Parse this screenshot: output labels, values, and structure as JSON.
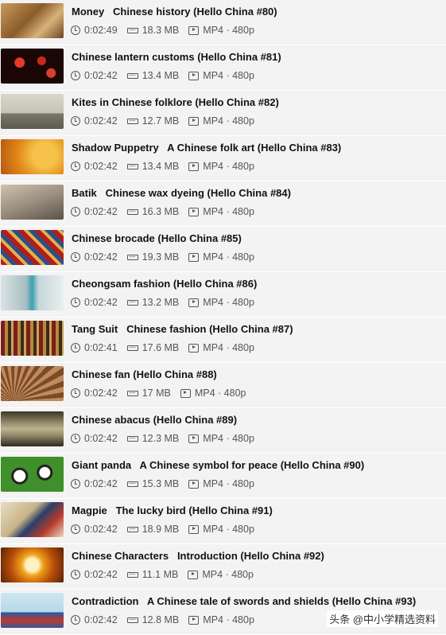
{
  "items": [
    {
      "title": "Money   Chinese history (Hello China #80)",
      "duration": "0:02:49",
      "size": "18.3 MB",
      "format": "MP4 · 480p",
      "thumb": "t-money"
    },
    {
      "title": "Chinese lantern customs (Hello China #81)",
      "duration": "0:02:42",
      "size": "13.4 MB",
      "format": "MP4 · 480p",
      "thumb": "t-lantern"
    },
    {
      "title": "Kites in Chinese folklore (Hello China #82)",
      "duration": "0:02:42",
      "size": "12.7 MB",
      "format": "MP4 · 480p",
      "thumb": "t-kites"
    },
    {
      "title": "Shadow Puppetry   A Chinese folk art (Hello China #83)",
      "duration": "0:02:42",
      "size": "13.4 MB",
      "format": "MP4 · 480p",
      "thumb": "t-shadow"
    },
    {
      "title": "Batik   Chinese wax dyeing (Hello China #84)",
      "duration": "0:02:42",
      "size": "16.3 MB",
      "format": "MP4 · 480p",
      "thumb": "t-batik"
    },
    {
      "title": "Chinese brocade (Hello China #85)",
      "duration": "0:02:42",
      "size": "19.3 MB",
      "format": "MP4 · 480p",
      "thumb": "t-brocade"
    },
    {
      "title": "Cheongsam fashion (Hello China #86)",
      "duration": "0:02:42",
      "size": "13.2 MB",
      "format": "MP4 · 480p",
      "thumb": "t-cheong"
    },
    {
      "title": "Tang Suit   Chinese fashion (Hello China #87)",
      "duration": "0:02:41",
      "size": "17.6 MB",
      "format": "MP4 · 480p",
      "thumb": "t-tang"
    },
    {
      "title": "Chinese fan (Hello China #88)",
      "duration": "0:02:42",
      "size": "17 MB",
      "format": "MP4 · 480p",
      "thumb": "t-fan"
    },
    {
      "title": "Chinese abacus (Hello China #89)",
      "duration": "0:02:42",
      "size": "12.3 MB",
      "format": "MP4 · 480p",
      "thumb": "t-abacus"
    },
    {
      "title": "Giant panda   A Chinese symbol for peace (Hello China #90)",
      "duration": "0:02:42",
      "size": "15.3 MB",
      "format": "MP4 · 480p",
      "thumb": "t-panda"
    },
    {
      "title": "Magpie   The lucky bird (Hello China #91)",
      "duration": "0:02:42",
      "size": "18.9 MB",
      "format": "MP4 · 480p",
      "thumb": "t-magpie"
    },
    {
      "title": "Chinese Characters   Introduction (Hello China #92)",
      "duration": "0:02:42",
      "size": "11.1 MB",
      "format": "MP4 · 480p",
      "thumb": "t-chars"
    },
    {
      "title": "Contradiction   A Chinese tale of swords and shields (Hello China #93)",
      "duration": "0:02:42",
      "size": "12.8 MB",
      "format": "MP4 · 480p",
      "thumb": "t-contra"
    }
  ],
  "icons": {
    "duration": "clock-icon",
    "size": "file-size-icon",
    "format": "video-icon"
  },
  "watermark": "头条 @中小学精选资料"
}
